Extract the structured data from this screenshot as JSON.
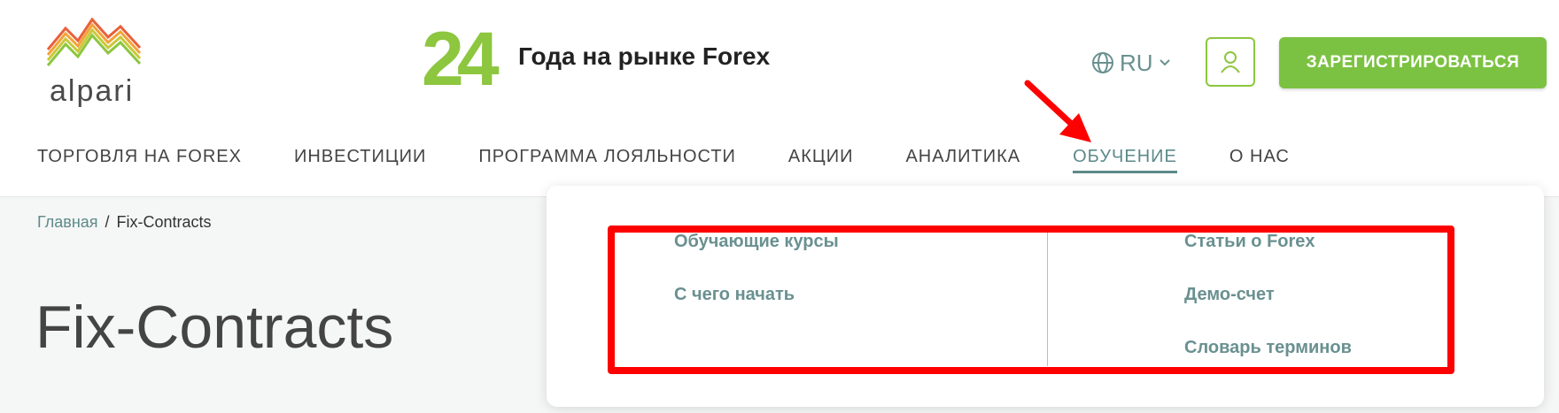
{
  "brand": {
    "logo_text": "alpari",
    "years_number": "24",
    "years_text": "Года на рынке Forex"
  },
  "header": {
    "language": "RU",
    "register_label": "ЗАРЕГИСТРИРОВАТЬСЯ"
  },
  "nav": {
    "items": [
      {
        "label": "ТОРГОВЛЯ НА FOREX"
      },
      {
        "label": "ИНВЕСТИЦИИ"
      },
      {
        "label": "ПРОГРАММА ЛОЯЛЬНОСТИ"
      },
      {
        "label": "АКЦИИ"
      },
      {
        "label": "АНАЛИТИКА"
      },
      {
        "label": "ОБУЧЕНИЕ"
      },
      {
        "label": "О НАС"
      }
    ],
    "active": "ОБУЧЕНИЕ"
  },
  "breadcrumb": {
    "home": "Главная",
    "separator": "/",
    "current": "Fix-Contracts"
  },
  "page": {
    "title": "Fix-Contracts"
  },
  "dropdown": {
    "left": [
      "Обучающие курсы",
      "С чего начать"
    ],
    "right": [
      "Статьи о Forex",
      "Демо-счет",
      "Словарь терминов"
    ]
  },
  "colors": {
    "accent": "#5d8a8a",
    "brand_green": "#7cc242",
    "highlight": "#ff0000"
  },
  "icons": {
    "language": "globe-icon",
    "lang_dropdown": "chevron-down-icon",
    "account": "user-icon"
  }
}
